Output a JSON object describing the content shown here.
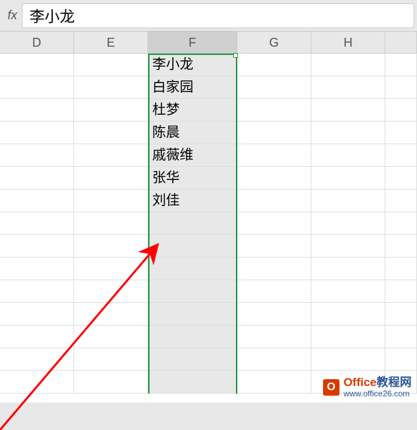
{
  "formula_bar": {
    "fx_label": "fx",
    "value": "李小龙"
  },
  "columns": [
    {
      "label": "D",
      "cls": "col-D",
      "selected": false
    },
    {
      "label": "E",
      "cls": "col-E",
      "selected": false
    },
    {
      "label": "F",
      "cls": "col-F",
      "selected": true
    },
    {
      "label": "G",
      "cls": "col-G",
      "selected": false
    },
    {
      "label": "H",
      "cls": "col-H",
      "selected": false
    },
    {
      "label": "",
      "cls": "col-I",
      "selected": false
    }
  ],
  "f_column_values": [
    "李小龙",
    "白家园",
    "杜梦",
    "陈晨",
    "戚薇维",
    "张华",
    "刘佳",
    "",
    "",
    "",
    "",
    "",
    "",
    "",
    ""
  ],
  "watermark": {
    "icon": "O",
    "title_1": "Office",
    "title_2": "教程网",
    "url": "www.office26.com"
  }
}
